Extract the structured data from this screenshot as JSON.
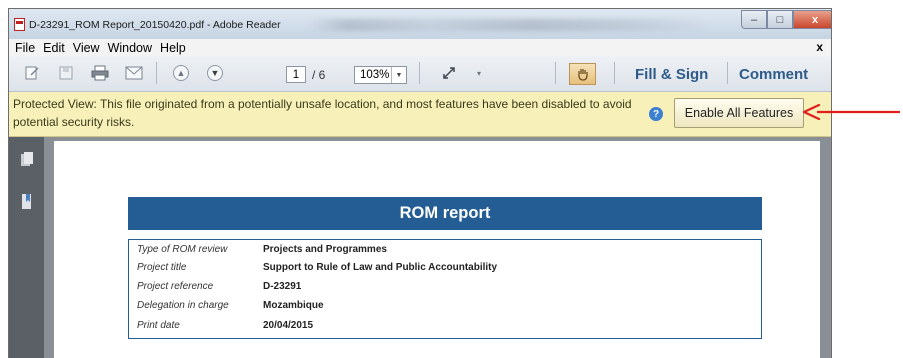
{
  "window": {
    "title": "D-23291_ROM Report_20150420.pdf - Adobe Reader",
    "controls": {
      "minimize": "–",
      "maximize": "□",
      "close": "x"
    }
  },
  "menubar": {
    "items": [
      "File",
      "Edit",
      "View",
      "Window",
      "Help"
    ],
    "close_label": "x"
  },
  "toolbar": {
    "current_page": "1",
    "page_total": "/ 6",
    "zoom": "103%",
    "fill_sign_label": "Fill & Sign",
    "comment_label": "Comment",
    "icons": [
      "create-icon",
      "save-icon",
      "print-icon",
      "email-icon",
      "prev-page-icon",
      "next-page-icon",
      "fullscreen-icon",
      "hand-tool-icon"
    ]
  },
  "protected_view": {
    "message": "Protected View: This file originated from a potentially unsafe location, and most features have been disabled to avoid potential security risks.",
    "button_label": "Enable All Features"
  },
  "document": {
    "banner_title": "ROM report",
    "rows": [
      {
        "label": "Type of ROM review",
        "value": "Projects and Programmes"
      },
      {
        "label": "Project title",
        "value": "Support to Rule of Law and Public Accountability"
      },
      {
        "label": "Project reference",
        "value": "D-23291"
      },
      {
        "label": "Delegation in charge",
        "value": "Mozambique"
      },
      {
        "label": "Print date",
        "value": "20/04/2015"
      }
    ]
  },
  "colors": {
    "banner": "#245d93",
    "protected_bar": "#f7f0b9",
    "arrow": "#e0201c",
    "accent_text": "#2e5b8a"
  }
}
